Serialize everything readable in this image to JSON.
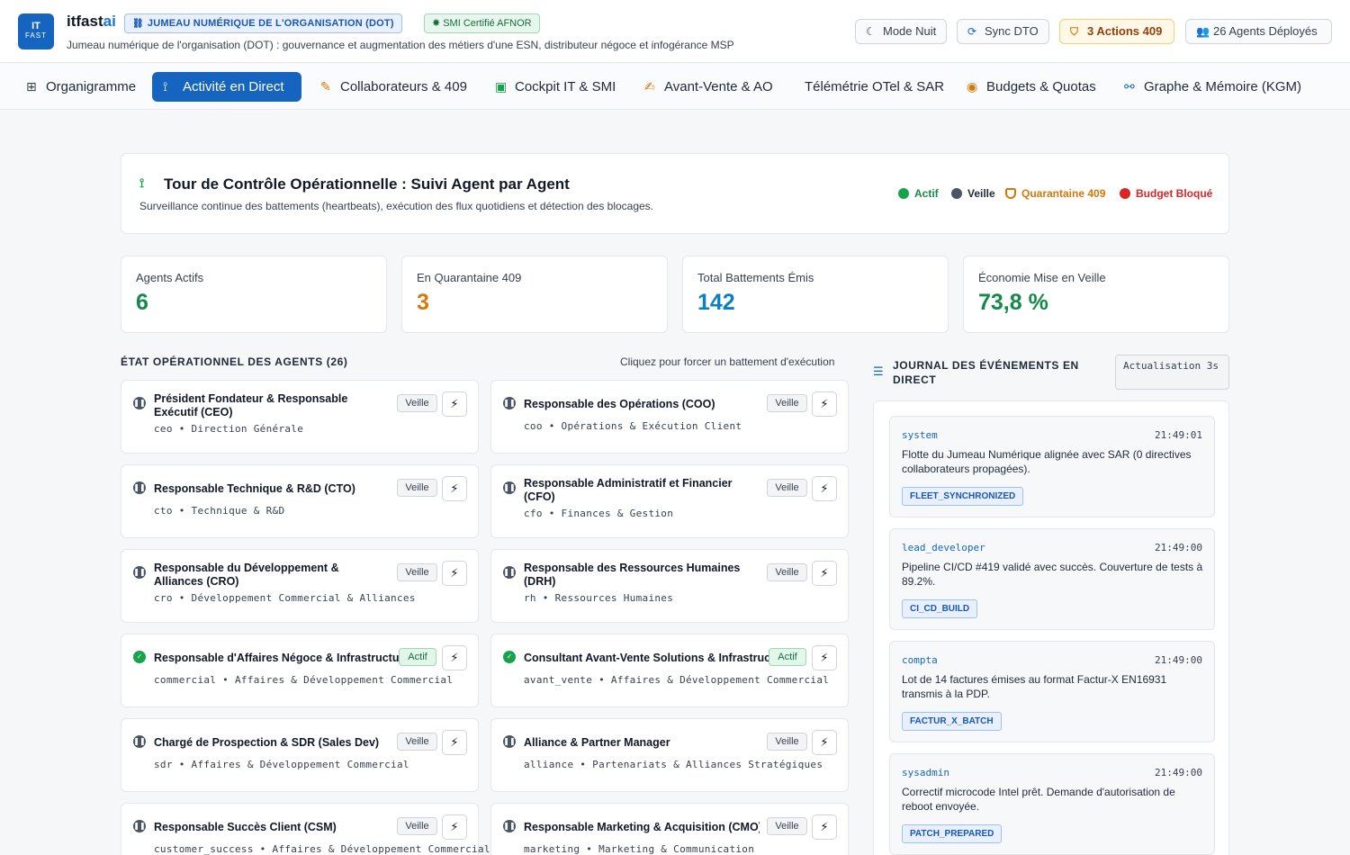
{
  "header": {
    "logo_line1": "IT",
    "logo_line2": "FAST",
    "brand_main": "itfast",
    "brand_accent": "ai",
    "badge_dot": "JUMEAU NUMÉRIQUE DE L'ORGANISATION (DOT)",
    "badge_smi": "SMI Certifié AFNOR",
    "subtitle": "Jumeau numérique de l'organisation (DOT) : gouvernance et augmentation des métiers d'une ESN, distributeur négoce et infogérance MSP",
    "buttons": {
      "night": "Mode Nuit",
      "sync": "Sync DTO",
      "actions": "3 Actions 409",
      "agents": "26 Agents Déployés"
    }
  },
  "nav": {
    "tabs": [
      {
        "label": "Organigramme",
        "icon": "sitemap-icon"
      },
      {
        "label": "Activité en Direct",
        "icon": "antenna-icon",
        "active": true
      },
      {
        "label": "Collaborateurs & 409",
        "icon": "user-edit-icon"
      },
      {
        "label": "Cockpit IT & SMI",
        "icon": "briefcase-icon"
      },
      {
        "label": "Avant-Vente & AO",
        "icon": "edit-icon"
      },
      {
        "label": "Télémétrie OTel & SAR",
        "icon": ""
      },
      {
        "label": "Budgets & Quotas",
        "icon": "coins-icon"
      },
      {
        "label": "Graphe & Mémoire (KGM)",
        "icon": "graph-icon"
      }
    ]
  },
  "tower": {
    "title": "Tour de Contrôle Opérationnelle : Suivi Agent par Agent",
    "subtitle": "Surveillance continue des battements (heartbeats), exécution des flux quotidiens et détection des blocages.",
    "legend": {
      "actif": "Actif",
      "veille": "Veille",
      "quarantaine": "Quarantaine 409",
      "budget": "Budget Bloqué"
    }
  },
  "stats": [
    {
      "label": "Agents Actifs",
      "value": "6",
      "color": "#16894a"
    },
    {
      "label": "En Quarantaine 409",
      "value": "3",
      "color": "#d97706"
    },
    {
      "label": "Total Battements Émis",
      "value": "142",
      "color": "#0b7fc1"
    },
    {
      "label": "Économie Mise en Veille",
      "value": "73,8 %",
      "color": "#16894a"
    }
  ],
  "agents_section": {
    "title": "ÉTAT OPÉRATIONNEL DES AGENTS (26)",
    "hint": "Cliquez pour forcer un battement d'exécution"
  },
  "agents": [
    {
      "name": "Président Fondateur & Responsable Exécutif (CEO)",
      "meta": "ceo • Direction Générale",
      "status": "Veille"
    },
    {
      "name": "Responsable des Opérations (COO)",
      "meta": "coo • Opérations & Exécution Client",
      "status": "Veille"
    },
    {
      "name": "Responsable Technique & R&D (CTO)",
      "meta": "cto • Technique & R&D",
      "status": "Veille"
    },
    {
      "name": "Responsable Administratif et Financier (CFO)",
      "meta": "cfo • Finances & Gestion",
      "status": "Veille"
    },
    {
      "name": "Responsable du Développement & Alliances (CRO)",
      "meta": "cro • Développement Commercial & Alliances",
      "status": "Veille"
    },
    {
      "name": "Responsable des Ressources Humaines (DRH)",
      "meta": "rh • Ressources Humaines",
      "status": "Veille"
    },
    {
      "name": "Responsable d'Affaires Négoce & Infrastructure",
      "meta": "commercial • Affaires & Développement Commercial",
      "status": "Actif"
    },
    {
      "name": "Consultant Avant-Vente Solutions & Infrastructure",
      "meta": "avant_vente • Affaires & Développement Commercial",
      "status": "Actif"
    },
    {
      "name": "Chargé de Prospection & SDR (Sales Dev)",
      "meta": "sdr • Affaires & Développement Commercial",
      "status": "Veille"
    },
    {
      "name": "Alliance & Partner Manager",
      "meta": "alliance • Partenariats & Alliances Stratégiques",
      "status": "Veille"
    },
    {
      "name": "Responsable Succès Client (CSM)",
      "meta": "customer_success • Affaires & Développement Commercial",
      "status": "Veille"
    },
    {
      "name": "Responsable Marketing & Acquisition (CMO)",
      "meta": "marketing • Marketing & Communication",
      "status": "Veille"
    }
  ],
  "journal": {
    "title": "JOURNAL DES ÉVÉNEMENTS EN DIRECT",
    "refresh": "Actualisation 3s",
    "events": [
      {
        "source": "system",
        "time": "21:49:01",
        "message": "Flotte du Jumeau Numérique alignée avec SAR (0 directives collaborateurs propagées).",
        "tag": "FLEET_SYNCHRONIZED"
      },
      {
        "source": "lead_developer",
        "time": "21:49:00",
        "message": "Pipeline CI/CD #419 validé avec succès. Couverture de tests à 89.2%.",
        "tag": "CI_CD_BUILD"
      },
      {
        "source": "compta",
        "time": "21:49:00",
        "message": "Lot de 14 factures émises au format Factur-X EN16931 transmis à la PDP.",
        "tag": "FACTUR_X_BATCH"
      },
      {
        "source": "sysadmin",
        "time": "21:49:00",
        "message": "Correctif microcode Intel prêt. Demande d'autorisation de reboot envoyée.",
        "tag": "PATCH_PREPARED"
      }
    ]
  },
  "colors": {
    "primary": "#1565c0",
    "actif": "#16a34a",
    "veille": "#4b5563",
    "quarantaine": "#d97706",
    "budget": "#dc2626"
  }
}
